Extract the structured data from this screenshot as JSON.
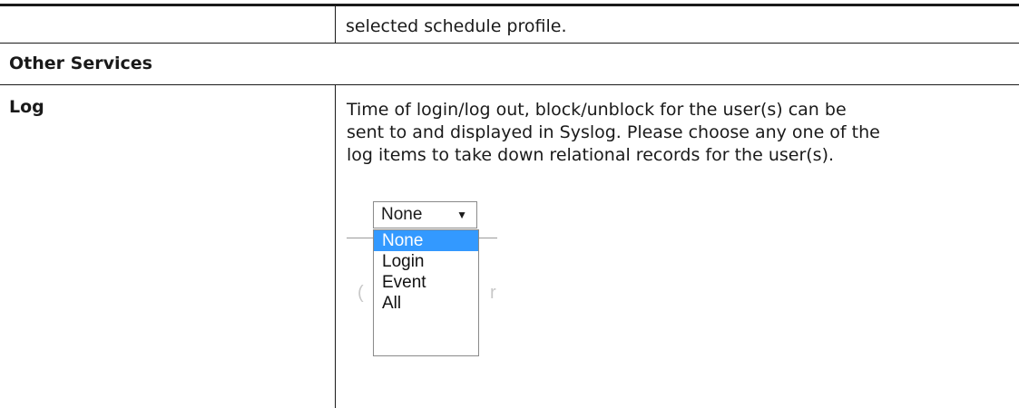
{
  "top_row": {
    "description_tail": "selected schedule profile."
  },
  "section": {
    "title": "Other Services"
  },
  "log_row": {
    "label": "Log",
    "description": "Time of login/log out, block/unblock for the user(s) can be\nsent to and displayed in Syslog. Please choose any one of the\nlog items to take down relational records for the user(s)."
  },
  "log_select": {
    "selected": "None",
    "arrow_icon": "dropdown-arrow-icon",
    "options": [
      "None",
      "Login",
      "Event",
      "All"
    ],
    "highlighted_option": "None"
  },
  "colors": {
    "highlight": "#3399ff",
    "rule": "#1a1a1a"
  }
}
